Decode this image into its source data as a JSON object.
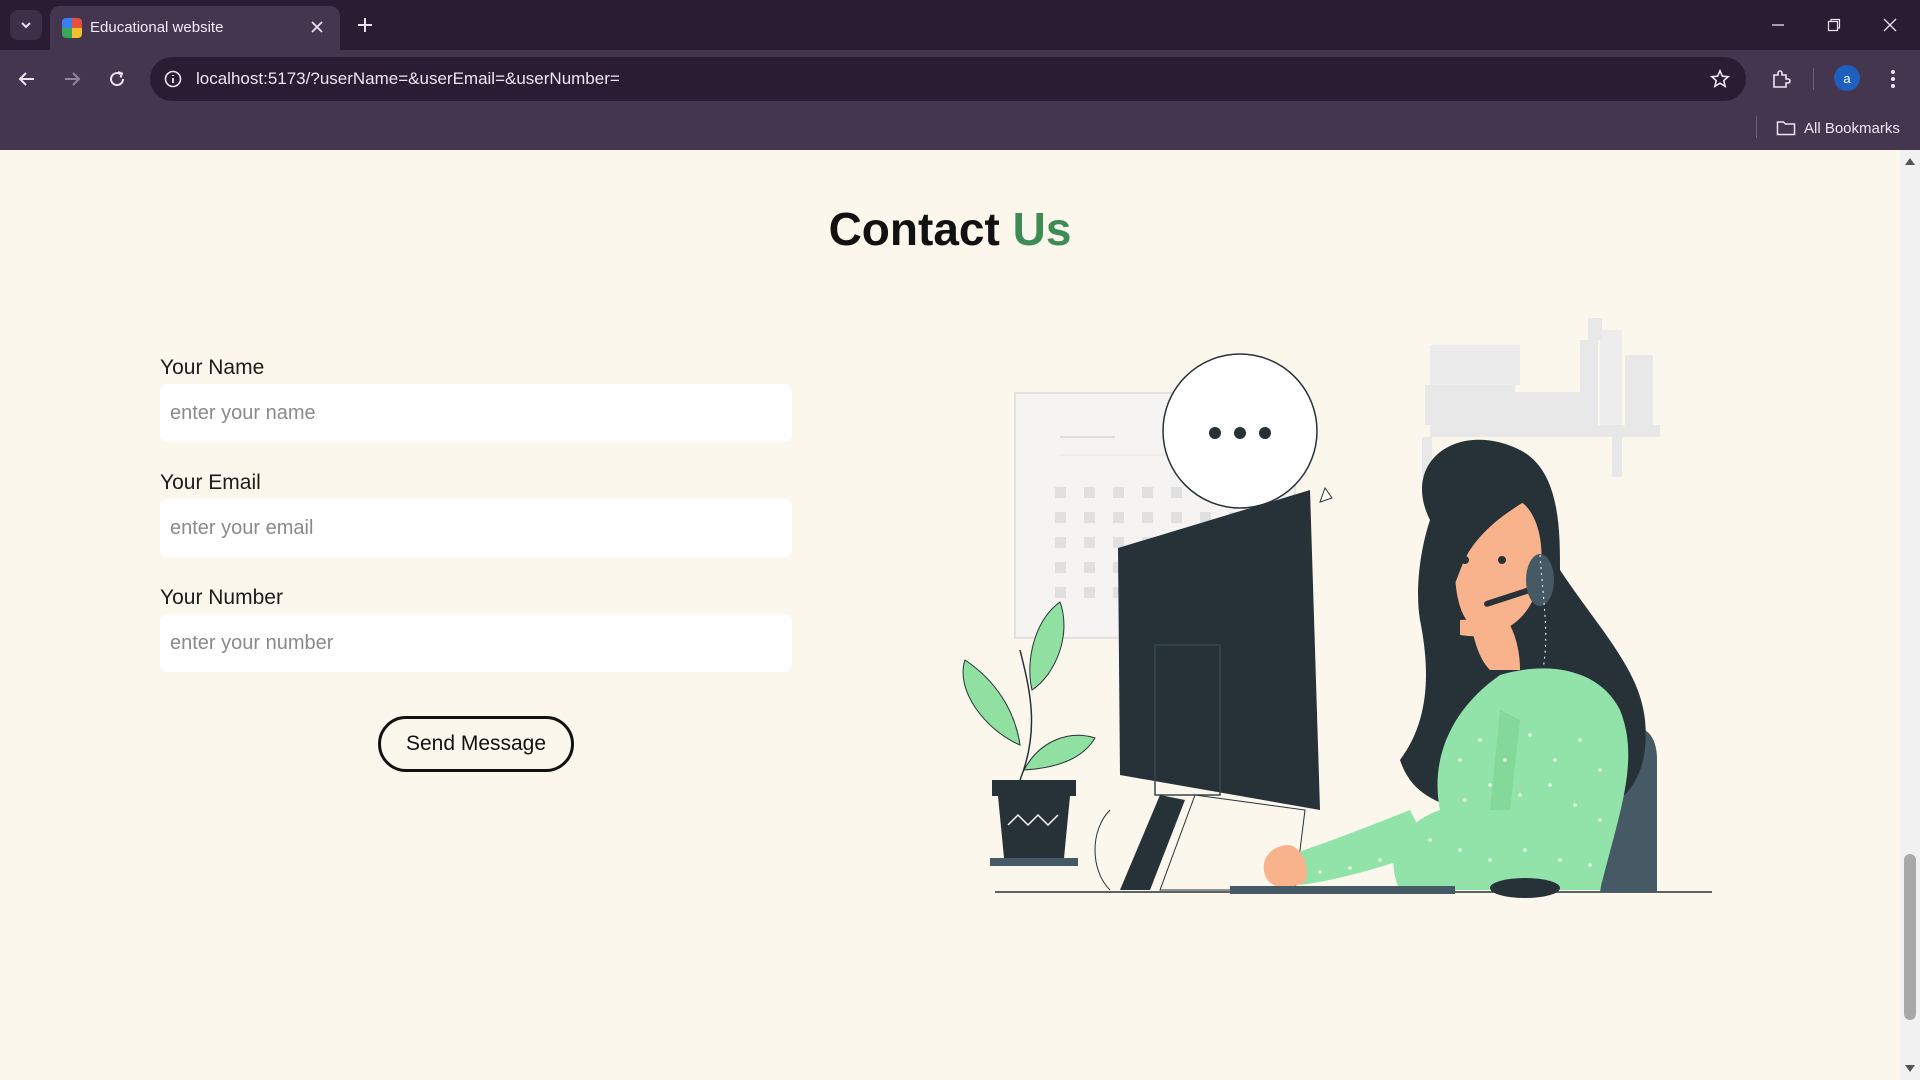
{
  "browser": {
    "tab_title": "Educational website",
    "url": "localhost:5173/?userName=&userEmail=&userNumber=",
    "bookmarks_label": "All Bookmarks",
    "profile_initial": "a"
  },
  "page": {
    "heading_main": "Contact",
    "heading_accent": "Us",
    "accent_color": "#3f8b55",
    "form": {
      "name_label": "Your Name",
      "name_placeholder": "enter your name",
      "name_value": "",
      "email_label": "Your Email",
      "email_placeholder": "enter your email",
      "email_value": "",
      "number_label": "Your Number",
      "number_placeholder": "enter your number",
      "number_value": "",
      "submit_label": "Send Message"
    }
  },
  "icons": [
    "tab-list-icon",
    "favicon-icon",
    "close-tab-icon",
    "new-tab-icon",
    "minimize-icon",
    "restore-icon",
    "close-window-icon",
    "back-icon",
    "forward-icon",
    "reload-icon",
    "site-info-icon",
    "bookmark-star-icon",
    "extensions-icon",
    "menu-icon",
    "folder-icon"
  ]
}
